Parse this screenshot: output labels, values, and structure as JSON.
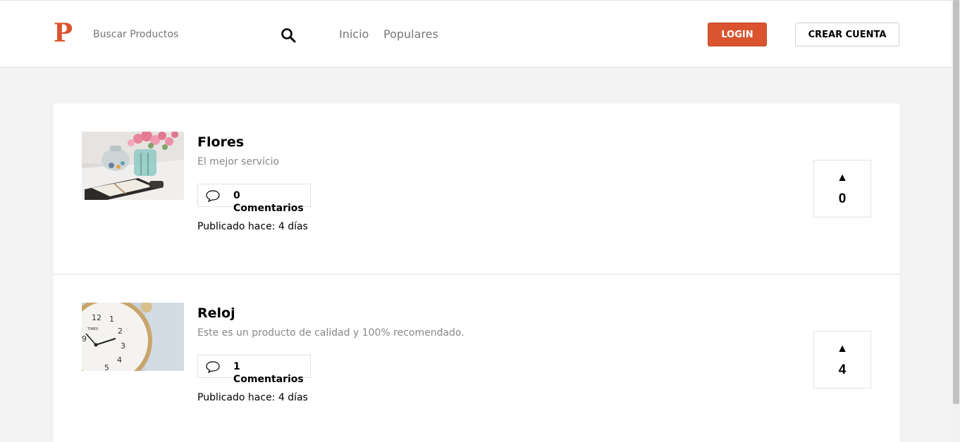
{
  "header": {
    "logo_text": "P",
    "search": {
      "placeholder": "Buscar Productos",
      "value": ""
    },
    "nav": [
      {
        "label": "Inicio"
      },
      {
        "label": "Populares"
      }
    ],
    "login_label": "LOGIN",
    "create_account_label": "CREAR CUENTA"
  },
  "colors": {
    "accent": "#da552f",
    "background": "#f3f3f3",
    "muted_text": "#888888"
  },
  "products": [
    {
      "title": "Flores",
      "description": "El mejor servicio",
      "image": "flowers-vase-planner-photo",
      "comments_label": "0 Comentarios",
      "published_label": "Publicado hace: 4 días",
      "vote_arrow": "▲",
      "votes": "0"
    },
    {
      "title": "Reloj",
      "description": "Este es un producto de calidad y 100% recomendado.",
      "image": "alarm-clock-photo",
      "comments_label": "1 Comentarios",
      "published_label": "Publicado hace: 4 días",
      "vote_arrow": "▲",
      "votes": "4"
    }
  ]
}
